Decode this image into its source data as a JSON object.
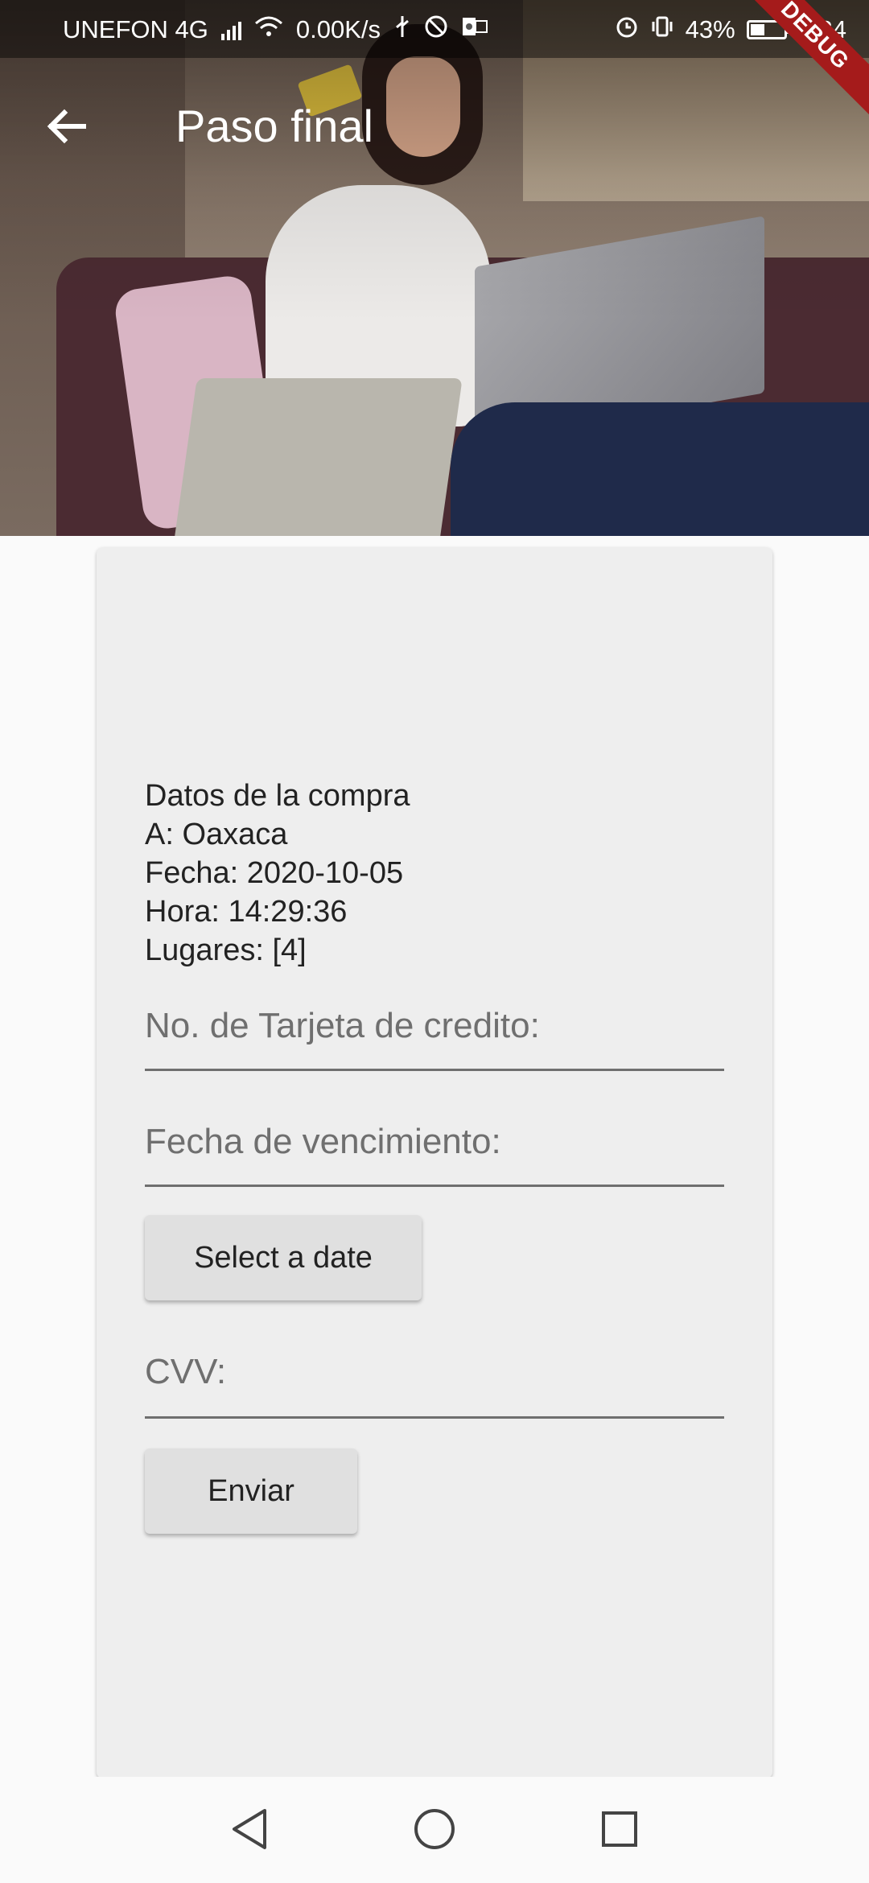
{
  "status_bar": {
    "carrier": "UNEFON 4G",
    "speed": "0.00K/s",
    "battery": "43%",
    "time": "1:34"
  },
  "debug_banner": "DEBUG",
  "app_bar": {
    "title": "Paso final",
    "back_icon": "arrow-back-icon"
  },
  "purchase": {
    "heading": "Datos de la compra",
    "destination": "A: Oaxaca",
    "date": "Fecha: 2020-10-05",
    "time": "Hora: 14:29:36",
    "seats": "Lugares: [4]"
  },
  "form": {
    "card_number_placeholder": "No. de Tarjeta de credito:",
    "expiry_placeholder": "Fecha de vencimiento:",
    "select_date_label": "Select a date",
    "cvv_placeholder": "CVV:",
    "submit_label": "Enviar"
  },
  "nav_bar": {
    "back": "triangle-back-icon",
    "home": "circle-home-icon",
    "recents": "square-recents-icon"
  }
}
